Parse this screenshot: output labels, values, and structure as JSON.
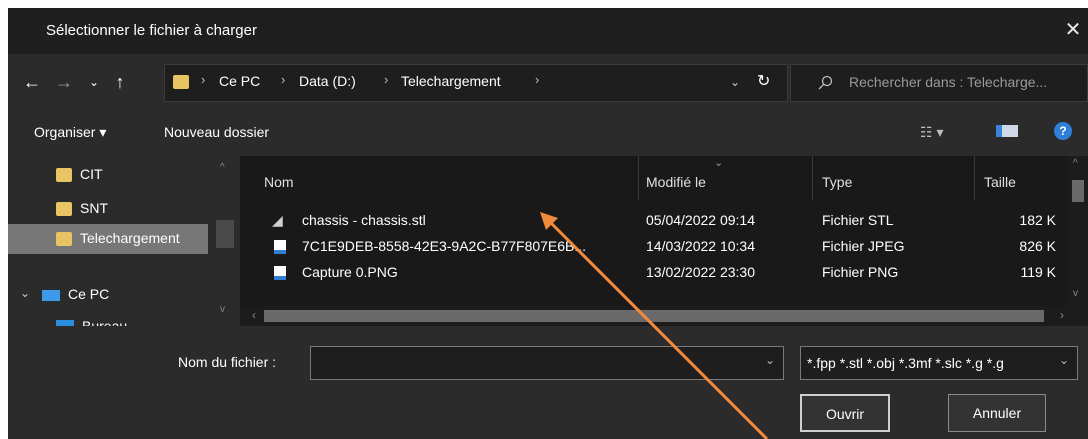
{
  "window": {
    "title": "Sélectionner le fichier à charger",
    "close_icon": "close-icon"
  },
  "nav": {
    "back_icon": "arrow-left-icon",
    "forward_icon": "arrow-right-icon",
    "recent_icon": "chevron-down-icon",
    "up_icon": "arrow-up-icon"
  },
  "address": {
    "crumbs": [
      "Ce PC",
      "Data (D:)",
      "Telechargement"
    ],
    "separator": "›",
    "dropdown_icon": "chevron-down-icon",
    "refresh_icon": "refresh-icon"
  },
  "search": {
    "placeholder": "Rechercher dans : Telecharge...",
    "icon": "search-icon"
  },
  "toolbar": {
    "organize": "Organiser ▾",
    "new_folder": "Nouveau dossier",
    "view_icon": "view-list-icon",
    "pane_icon": "preview-pane-icon",
    "help_icon": "help-icon",
    "help_glyph": "?"
  },
  "sidebar": {
    "items": [
      {
        "label": "CIT"
      },
      {
        "label": "SNT"
      },
      {
        "label": "Telechargement"
      },
      {
        "label": "Ce PC"
      },
      {
        "label": "Bureau"
      }
    ]
  },
  "columns": {
    "name": "Nom",
    "modified": "Modifié le",
    "type": "Type",
    "size": "Taille"
  },
  "files": [
    {
      "name": "chassis - chassis.stl",
      "modified": "05/04/2022 09:14",
      "type": "Fichier STL",
      "size": "182 K"
    },
    {
      "name": "7C1E9DEB-8558-42E3-9A2C-B77F807E6B...",
      "modified": "14/03/2022 10:34",
      "type": "Fichier JPEG",
      "size": "826 K"
    },
    {
      "name": "Capture 0.PNG",
      "modified": "13/02/2022 23:30",
      "type": "Fichier PNG",
      "size": "119 K"
    }
  ],
  "bottom": {
    "filename_label": "Nom du fichier :",
    "filename_value": "",
    "filter": "*.fpp *.stl *.obj *.3mf *.slc *.g *.g",
    "open": "Ouvrir",
    "cancel": "Annuler"
  },
  "colors": {
    "annotation_arrow": "#f08a3c",
    "folder": "#e8c462",
    "accent": "#2f7fd6"
  }
}
